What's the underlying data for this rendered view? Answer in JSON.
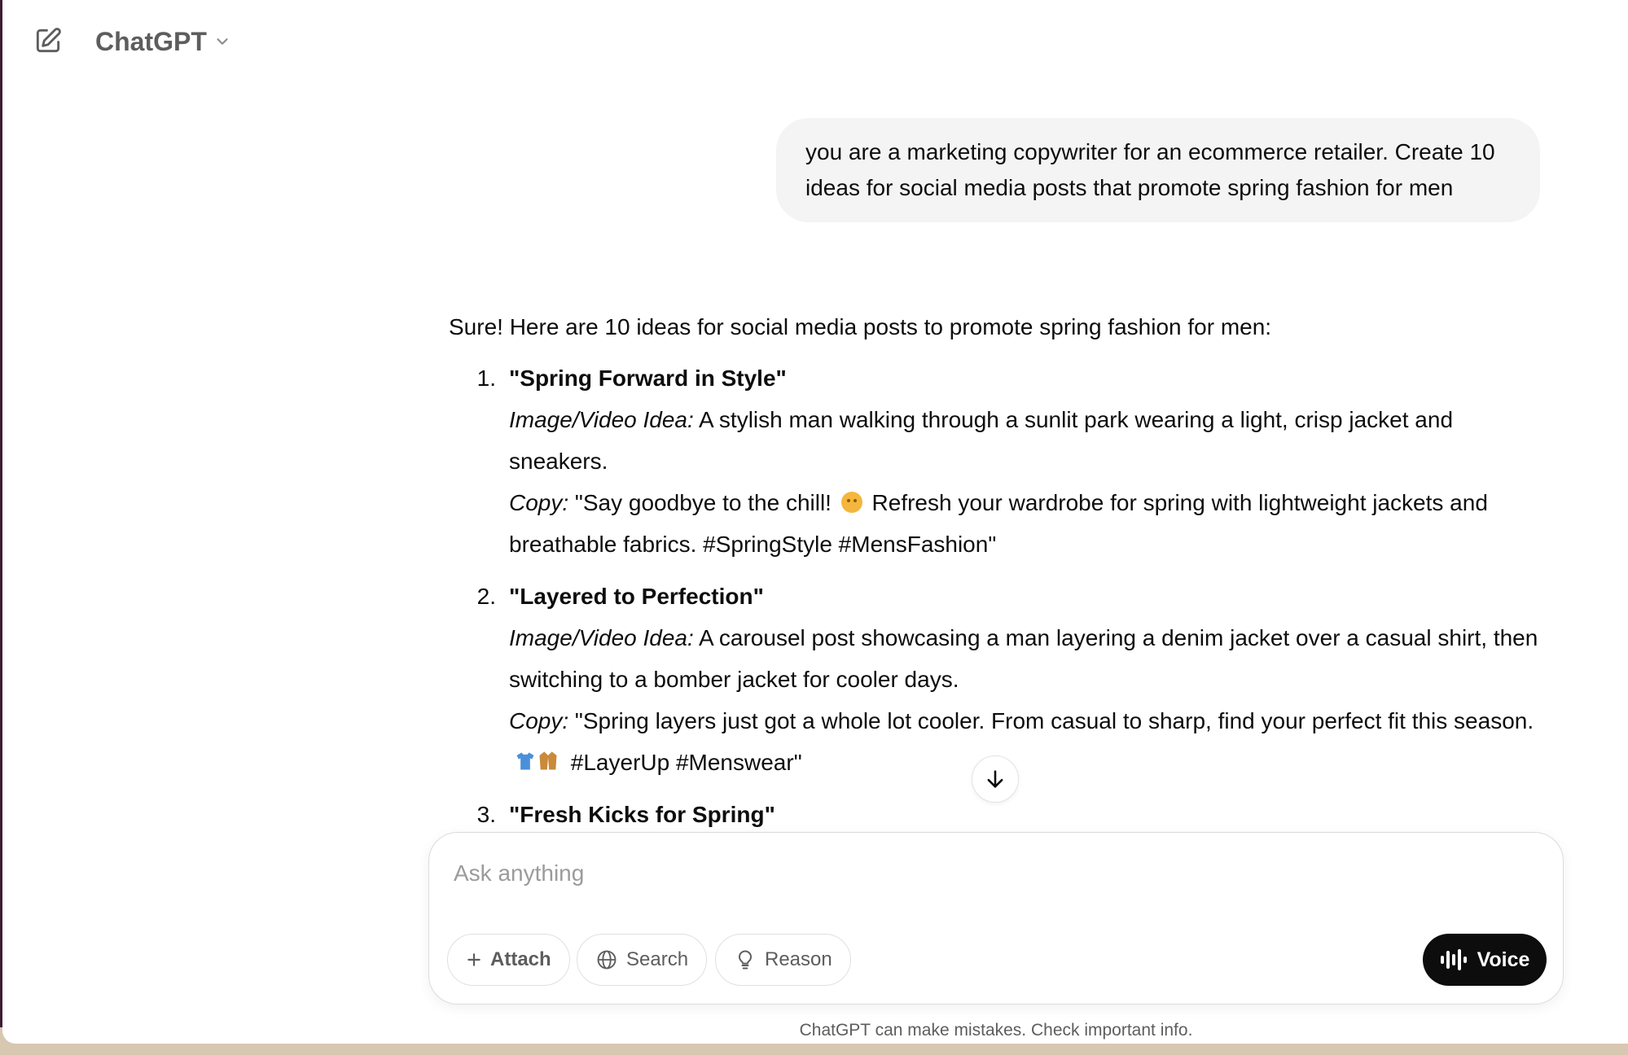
{
  "header": {
    "model_name": "ChatGPT"
  },
  "conversation": {
    "user_message": "you are a marketing copywriter for an ecommerce retailer. Create 10 ideas for social media posts that promote spring fashion for men",
    "assistant": {
      "intro": "Sure! Here are 10 ideas for social media posts to promote spring fashion for men:",
      "ideas": [
        {
          "number": "1.",
          "title": "\"Spring Forward in Style\"",
          "image_label": "Image/Video Idea:",
          "image_text": " A stylish man walking through a sunlit park wearing a light, crisp jacket and sneakers.",
          "copy_label": "Copy:",
          "copy_text_a": " \"Say goodbye to the chill! ",
          "copy_text_b": " Refresh your wardrobe for spring with lightweight jackets and breathable fabrics. #SpringStyle #MensFashion\""
        },
        {
          "number": "2.",
          "title": "\"Layered to Perfection\"",
          "image_label": "Image/Video Idea:",
          "image_text": " A carousel post showcasing a man layering a denim jacket over a casual shirt, then switching to a bomber jacket for cooler days.",
          "copy_label": "Copy:",
          "copy_text_a": " \"Spring layers just got a whole lot cooler. From casual to sharp, find your perfect fit this season.",
          "copy_text_b": " #LayerUp #Menswear\""
        },
        {
          "number": "3.",
          "title": "\"Fresh Kicks for Spring\""
        }
      ]
    }
  },
  "composer": {
    "placeholder": "Ask anything",
    "attach_label": "Attach",
    "search_label": "Search",
    "reason_label": "Reason",
    "voice_label": "Voice"
  },
  "footer": {
    "disclaimer": "ChatGPT can make mistakes. Check important info."
  }
}
